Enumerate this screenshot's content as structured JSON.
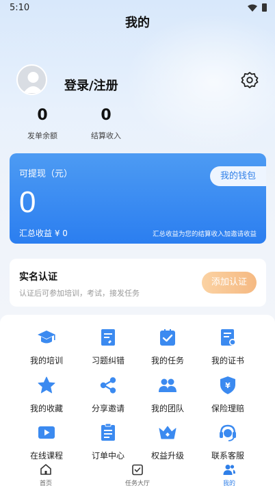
{
  "status_bar": {
    "time": "5:10"
  },
  "header": {
    "title": "我的"
  },
  "profile": {
    "login_label": "登录/注册"
  },
  "stats": [
    {
      "value": "0",
      "label": "发单余额"
    },
    {
      "value": "0",
      "label": "结算收入"
    }
  ],
  "balance": {
    "label": "可提现（元）",
    "amount": "0",
    "wallet_button": "我的钱包",
    "total": "汇总收益 ¥ 0",
    "note": "汇总收益为您的结算收入加邀请收益"
  },
  "verification": {
    "title": "实名认证",
    "subtitle": "认证后可参加培训，考试，接发任务",
    "button": "添加认证"
  },
  "menu": [
    {
      "label": "我的培训",
      "icon": "graduation-cap-icon"
    },
    {
      "label": "习题纠错",
      "icon": "exercise-correction-icon"
    },
    {
      "label": "我的任务",
      "icon": "task-check-icon"
    },
    {
      "label": "我的证书",
      "icon": "certificate-icon"
    },
    {
      "label": "我的收藏",
      "icon": "star-icon"
    },
    {
      "label": "分享邀请",
      "icon": "share-icon"
    },
    {
      "label": "我的团队",
      "icon": "team-icon"
    },
    {
      "label": "保险理赔",
      "icon": "insurance-shield-icon"
    },
    {
      "label": "在线课程",
      "icon": "video-course-icon"
    },
    {
      "label": "订单中心",
      "icon": "order-list-icon"
    },
    {
      "label": "权益升级",
      "icon": "crown-icon"
    },
    {
      "label": "联系客服",
      "icon": "headset-icon"
    }
  ],
  "bottom_nav": [
    {
      "label": "首页",
      "icon": "home-icon"
    },
    {
      "label": "任务大厅",
      "icon": "task-hall-icon"
    },
    {
      "label": "我的",
      "icon": "profile-icon",
      "active": true
    }
  ],
  "colors": {
    "accent": "#2f7fe8",
    "verify_button": "#f5b982",
    "icon_blue": "#3b8af0"
  }
}
